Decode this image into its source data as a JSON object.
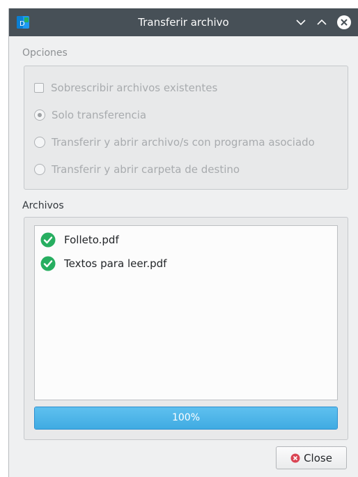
{
  "window": {
    "title": "Transferir archivo"
  },
  "options": {
    "label": "Opciones",
    "overwrite": {
      "label": "Sobrescribir archivos existentes",
      "checked": false
    },
    "radios": [
      {
        "label": "Solo transferencia",
        "selected": true
      },
      {
        "label": "Transferir y abrir archivo/s con programa asociado",
        "selected": false
      },
      {
        "label": "Transferir y abrir carpeta de destino",
        "selected": false
      }
    ]
  },
  "files": {
    "label": "Archivos",
    "items": [
      {
        "name": "Folleto.pdf",
        "status": "done"
      },
      {
        "name": "Textos para leer.pdf",
        "status": "done"
      }
    ]
  },
  "progress": {
    "value": 100,
    "text": "100%"
  },
  "buttons": {
    "close_label": "Close"
  },
  "colors": {
    "titlebar": "#475057",
    "accent": "#3daee9",
    "success": "#27ae60",
    "danger": "#da4453"
  },
  "icons": {
    "app": "app-icon",
    "minimize": "chevron-down-icon",
    "maximize": "chevron-up-icon",
    "close": "close-circle-icon",
    "file_done": "check-circle-icon",
    "button_close": "close-circle-icon"
  }
}
